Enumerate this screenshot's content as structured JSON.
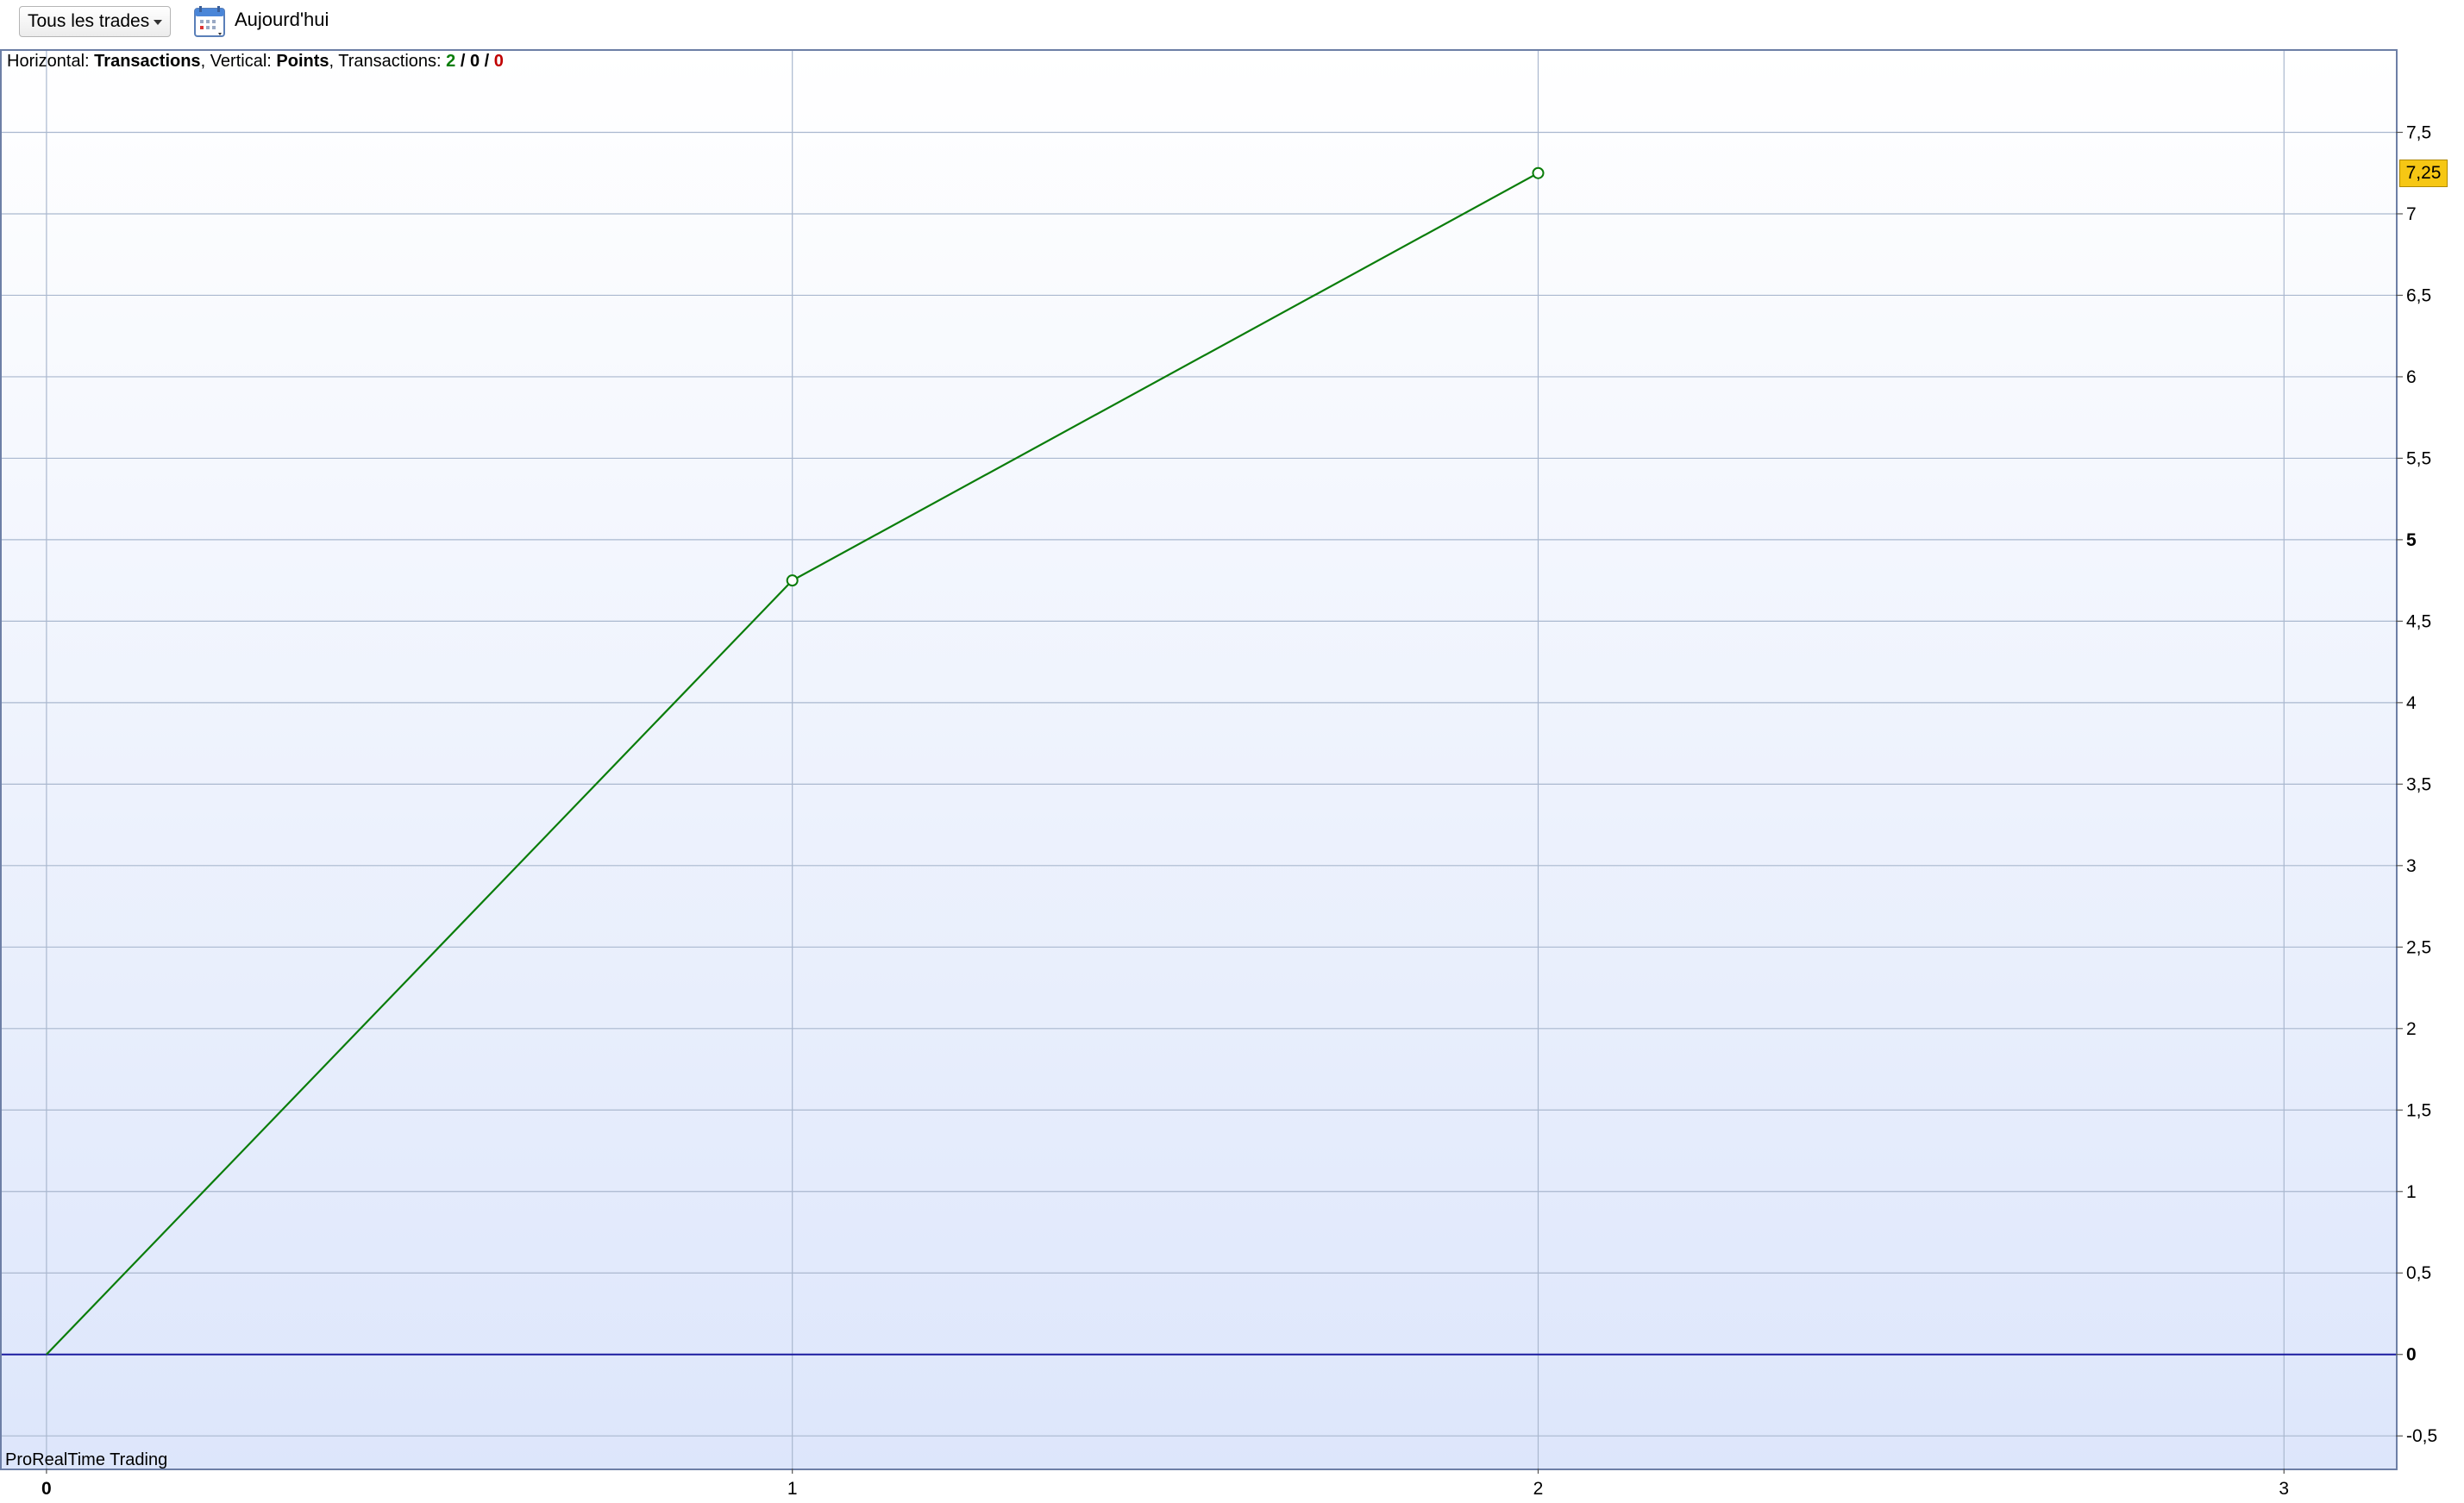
{
  "toolbar": {
    "filter_dropdown": {
      "selected": "Tous les trades"
    },
    "calendar_icon": "calendar-icon",
    "date_label": "Aujourd'hui"
  },
  "chart_header": {
    "horizontal_label": "Horizontal:",
    "horizontal_value": "Transactions",
    "vertical_label": "Vertical:",
    "vertical_value": "Points",
    "transactions_label": "Transactions:",
    "transactions_winning": "2",
    "transactions_neutral": "0",
    "transactions_losing": "0",
    "separator": "/"
  },
  "watermark": "ProRealTime Trading",
  "current_value_badge": "7,25",
  "colors": {
    "series_line": "#0a7d0a",
    "zero_line": "#1a1aa0",
    "grid": "#aab8cf",
    "badge": "#f6c714",
    "winning": "#0a7d0a",
    "losing": "#c00000"
  },
  "chart_data": {
    "type": "line",
    "x": [
      0,
      1,
      2
    ],
    "series": [
      {
        "values": [
          0,
          4.75,
          7.25
        ]
      }
    ],
    "xlim": [
      -0.06,
      3.15
    ],
    "ylim": [
      -0.7,
      8.0
    ],
    "x_ticks": [
      {
        "value": 0,
        "label": "0",
        "bold": true
      },
      {
        "value": 1,
        "label": "1",
        "bold": false
      },
      {
        "value": 2,
        "label": "2",
        "bold": false
      },
      {
        "value": 3,
        "label": "3",
        "bold": false
      }
    ],
    "y_ticks": [
      {
        "value": -0.5,
        "label": "-0,5",
        "bold": false
      },
      {
        "value": 0,
        "label": "0",
        "bold": true
      },
      {
        "value": 0.5,
        "label": "0,5",
        "bold": false
      },
      {
        "value": 1,
        "label": "1",
        "bold": false
      },
      {
        "value": 1.5,
        "label": "1,5",
        "bold": false
      },
      {
        "value": 2,
        "label": "2",
        "bold": false
      },
      {
        "value": 2.5,
        "label": "2,5",
        "bold": false
      },
      {
        "value": 3,
        "label": "3",
        "bold": false
      },
      {
        "value": 3.5,
        "label": "3,5",
        "bold": false
      },
      {
        "value": 4,
        "label": "4",
        "bold": false
      },
      {
        "value": 4.5,
        "label": "4,5",
        "bold": false
      },
      {
        "value": 5,
        "label": "5",
        "bold": true
      },
      {
        "value": 5.5,
        "label": "5,5",
        "bold": false
      },
      {
        "value": 6,
        "label": "6",
        "bold": false
      },
      {
        "value": 6.5,
        "label": "6,5",
        "bold": false
      },
      {
        "value": 7,
        "label": "7",
        "bold": false
      },
      {
        "value": 7.5,
        "label": "7,5",
        "bold": false
      }
    ],
    "grid": true,
    "current_value": 7.25
  }
}
